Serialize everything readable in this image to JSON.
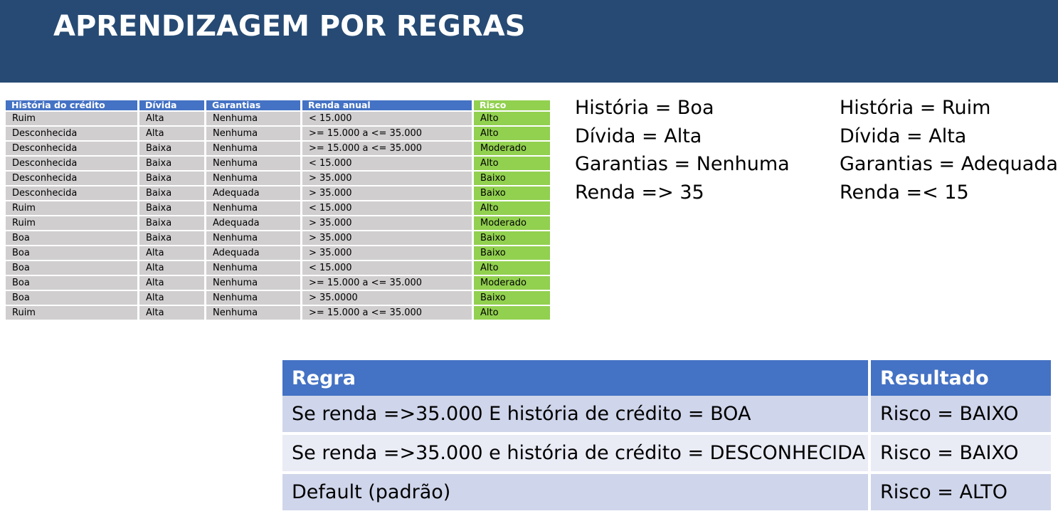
{
  "title": "APRENDIZAGEM POR REGRAS",
  "data_table": {
    "headers": [
      "História do crédito",
      "Dívida",
      "Garantias",
      "Renda anual",
      "Risco"
    ],
    "rows": [
      [
        "Ruim",
        "Alta",
        "Nenhuma",
        "< 15.000",
        "Alto"
      ],
      [
        "Desconhecida",
        "Alta",
        "Nenhuma",
        ">= 15.000 a <= 35.000",
        "Alto"
      ],
      [
        "Desconhecida",
        "Baixa",
        "Nenhuma",
        ">= 15.000 a <= 35.000",
        "Moderado"
      ],
      [
        "Desconhecida",
        "Baixa",
        "Nenhuma",
        "< 15.000",
        "Alto"
      ],
      [
        "Desconhecida",
        "Baixa",
        "Nenhuma",
        "> 35.000",
        "Baixo"
      ],
      [
        "Desconhecida",
        "Baixa",
        "Adequada",
        "> 35.000",
        "Baixo"
      ],
      [
        "Ruim",
        "Baixa",
        "Nenhuma",
        "< 15.000",
        "Alto"
      ],
      [
        "Ruim",
        "Baixa",
        "Adequada",
        "> 35.000",
        "Moderado"
      ],
      [
        "Boa",
        "Baixa",
        "Nenhuma",
        "> 35.000",
        "Baixo"
      ],
      [
        "Boa",
        "Alta",
        "Adequada",
        "> 35.000",
        "Baixo"
      ],
      [
        "Boa",
        "Alta",
        "Nenhuma",
        "< 15.000",
        "Alto"
      ],
      [
        "Boa",
        "Alta",
        "Nenhuma",
        ">= 15.000 a <= 35.000",
        "Moderado"
      ],
      [
        "Boa",
        "Alta",
        "Nenhuma",
        "> 35.0000",
        "Baixo"
      ],
      [
        "Ruim",
        "Alta",
        "Nenhuma",
        ">= 15.000 a <= 35.000",
        "Alto"
      ]
    ]
  },
  "case_a": [
    "História = Boa",
    "Dívida = Alta",
    "Garantias = Nenhuma",
    "Renda => 35"
  ],
  "case_b": [
    "História = Ruim",
    "Dívida = Alta",
    "Garantias = Adequada",
    "Renda =< 15"
  ],
  "rules_table": {
    "headers": [
      "Regra",
      "Resultado"
    ],
    "rows": [
      [
        "Se renda =>35.000 E história de crédito = BOA",
        "Risco = BAIXO"
      ],
      [
        "Se renda =>35.000 e história de crédito = DESCONHECIDA",
        "Risco = BAIXO"
      ],
      [
        "Default (padrão)",
        "Risco = ALTO"
      ]
    ]
  },
  "colors": {
    "header_bar": "#264a73",
    "table_header": "#4472c4",
    "risk_green": "#92d050",
    "cell_gray": "#d0cece",
    "rule_row_dark": "#cfd5ea",
    "rule_row_light": "#e9ebf5"
  }
}
